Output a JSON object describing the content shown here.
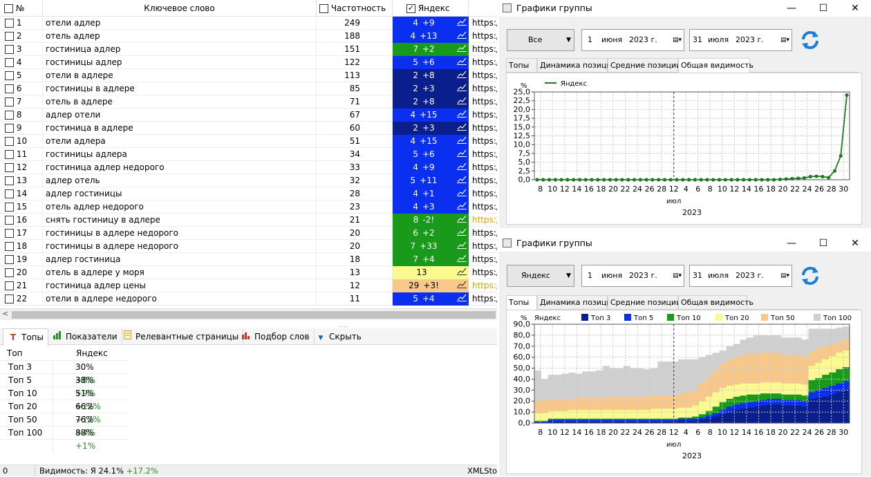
{
  "table": {
    "headers": {
      "num": "№",
      "keyword": "Ключевое слово",
      "freq": "Частотность",
      "yandex": "Яндекс"
    },
    "rows": [
      {
        "n": "1",
        "kw": "отели адлер",
        "f": "249",
        "pos": "4",
        "d": "+9",
        "bg": "#0b2fee",
        "fg": "#ffffff",
        "url": "https:/"
      },
      {
        "n": "2",
        "kw": "отель адлер",
        "f": "188",
        "pos": "4",
        "d": "+13",
        "bg": "#0b2fee",
        "fg": "#ffffff",
        "url": "https:/"
      },
      {
        "n": "3",
        "kw": "гостиница адлер",
        "f": "151",
        "pos": "7",
        "d": "+2",
        "bg": "#1a9a1a",
        "fg": "#ffffff",
        "url": "https:/"
      },
      {
        "n": "4",
        "kw": "гостиницы адлер",
        "f": "122",
        "pos": "5",
        "d": "+6",
        "bg": "#0b2fee",
        "fg": "#ffffff",
        "url": "https:/"
      },
      {
        "n": "5",
        "kw": "отели в адлере",
        "f": "113",
        "pos": "2",
        "d": "+8",
        "bg": "#0a1e8c",
        "fg": "#ffffff",
        "url": "https:/"
      },
      {
        "n": "6",
        "kw": "гостиницы в адлере",
        "f": "85",
        "pos": "2",
        "d": "+3",
        "bg": "#0a1e8c",
        "fg": "#ffffff",
        "url": "https:/"
      },
      {
        "n": "7",
        "kw": "отель в адлере",
        "f": "71",
        "pos": "2",
        "d": "+8",
        "bg": "#0a1e8c",
        "fg": "#ffffff",
        "url": "https:/"
      },
      {
        "n": "8",
        "kw": "адлер отели",
        "f": "67",
        "pos": "4",
        "d": "+15",
        "bg": "#0b2fee",
        "fg": "#ffffff",
        "url": "https:/"
      },
      {
        "n": "9",
        "kw": "гостиница в адлере",
        "f": "60",
        "pos": "2",
        "d": "+3",
        "bg": "#0a1e8c",
        "fg": "#ffffff",
        "url": "https:/"
      },
      {
        "n": "10",
        "kw": "отели адлера",
        "f": "51",
        "pos": "4",
        "d": "+15",
        "bg": "#0b2fee",
        "fg": "#ffffff",
        "url": "https:/"
      },
      {
        "n": "11",
        "kw": "гостиницы адлера",
        "f": "34",
        "pos": "5",
        "d": "+6",
        "bg": "#0b2fee",
        "fg": "#ffffff",
        "url": "https:/"
      },
      {
        "n": "12",
        "kw": "гостиница адлер недорого",
        "f": "33",
        "pos": "4",
        "d": "+9",
        "bg": "#0b2fee",
        "fg": "#ffffff",
        "url": "https:/"
      },
      {
        "n": "13",
        "kw": "адлер отель",
        "f": "32",
        "pos": "5",
        "d": "+11",
        "bg": "#0b2fee",
        "fg": "#ffffff",
        "url": "https:/"
      },
      {
        "n": "14",
        "kw": "адлер гостиницы",
        "f": "28",
        "pos": "4",
        "d": "+1",
        "bg": "#0b2fee",
        "fg": "#ffffff",
        "url": "https:/"
      },
      {
        "n": "15",
        "kw": "отель адлер недорого",
        "f": "23",
        "pos": "4",
        "d": "+3",
        "bg": "#0b2fee",
        "fg": "#ffffff",
        "url": "https:/"
      },
      {
        "n": "16",
        "kw": "снять гостиницу в адлере",
        "f": "21",
        "pos": "8",
        "d": "-2!",
        "bg": "#1a9a1a",
        "fg": "#ffffff",
        "url": "https:/",
        "urlc": "#e0a000"
      },
      {
        "n": "17",
        "kw": "гостиницы в адлере недорого",
        "f": "20",
        "pos": "6",
        "d": "+2",
        "bg": "#1a9a1a",
        "fg": "#ffffff",
        "url": "https:/"
      },
      {
        "n": "18",
        "kw": "гостиницы в адлере недорого",
        "f": "20",
        "pos": "7",
        "d": "+33",
        "bg": "#1a9a1a",
        "fg": "#ffffff",
        "url": "https:/"
      },
      {
        "n": "19",
        "kw": "адлер гостиница",
        "f": "18",
        "pos": "7",
        "d": "+4",
        "bg": "#1a9a1a",
        "fg": "#ffffff",
        "url": "https:/"
      },
      {
        "n": "20",
        "kw": "отель в адлере у моря",
        "f": "13",
        "pos": "13",
        "d": "",
        "bg": "#fafa90",
        "fg": "#000000",
        "url": "https:/"
      },
      {
        "n": "21",
        "kw": "гостиница адлер цены",
        "f": "12",
        "pos": "29",
        "d": "+3!",
        "bg": "#f7c88a",
        "fg": "#000000",
        "url": "https:/",
        "urlc": "#e0a000"
      },
      {
        "n": "22",
        "kw": "отели в адлере недорого",
        "f": "11",
        "pos": "5",
        "d": "+4",
        "bg": "#0b2fee",
        "fg": "#ffffff",
        "url": "https:/"
      }
    ]
  },
  "bottom_tabs": [
    "Топы",
    "Показатели",
    "Релевантные страницы",
    "Подбор слов",
    "Скрыть"
  ],
  "tops": {
    "col1": "Топ",
    "col2": "Яндекс",
    "rows": [
      {
        "name": "Топ 3",
        "pct": "30%",
        "d": "+8%"
      },
      {
        "name": "Топ 5",
        "pct": "38%",
        "d": "+9%"
      },
      {
        "name": "Топ 10",
        "pct": "51%",
        "d": "+12%"
      },
      {
        "name": "Топ 20",
        "pct": "66%",
        "d": "+12%"
      },
      {
        "name": "Топ 50",
        "pct": "76%",
        "d": "+4%"
      },
      {
        "name": "Топ 100",
        "pct": "88%",
        "d": "+1%"
      }
    ]
  },
  "status": {
    "count": "0",
    "vis_label": "Видимость:",
    "vis_engine": "Я",
    "vis_value": "24.1%",
    "vis_delta": "+17.2%",
    "right": "XMLSto"
  },
  "win1": {
    "title": "Графики группы",
    "engine_select": "Все",
    "date_from": {
      "d": "1",
      "m": "июня",
      "y": "2023 г."
    },
    "date_to": {
      "d": "31",
      "m": "июля",
      "y": "2023 г."
    },
    "tabs": [
      "Топы",
      "Динамика позиций",
      "Средние позиции",
      "Общая видимость"
    ],
    "active_tab": 3
  },
  "win2": {
    "title": "Графики группы",
    "engine_select": "Яндекс",
    "date_from": {
      "d": "1",
      "m": "июня",
      "y": "2023 г."
    },
    "date_to": {
      "d": "31",
      "m": "июля",
      "y": "2023 г."
    },
    "tabs": [
      "Топы",
      "Динамика позиций",
      "Средние позиции",
      "Общая видимость"
    ],
    "active_tab": 0
  },
  "colors": {
    "top3": "#0a1e8c",
    "top5": "#0b2fee",
    "top10": "#1a9a1a",
    "top20": "#fafa90",
    "top50": "#f7c88a",
    "top100": "#d0d0d0",
    "line": "#1f7a1f"
  },
  "chart_data": [
    {
      "type": "line",
      "ylabel": "%",
      "legend": [
        "Яндекс"
      ],
      "ylim": [
        0,
        25
      ],
      "yticks": [
        "0,0",
        "2,5",
        "5,0",
        "7,5",
        "10,0",
        "12,5",
        "15,0",
        "17,5",
        "20,0",
        "22,5",
        "25,0"
      ],
      "xticks": [
        "8",
        "10",
        "12",
        "14",
        "16",
        "18",
        "20",
        "22",
        "24",
        "26",
        "28",
        "12",
        "4",
        "6",
        "8",
        "10",
        "12",
        "14",
        "16",
        "18",
        "20",
        "22",
        "24",
        "26",
        "28",
        "30"
      ],
      "xlabel_month": "июл",
      "xlabel_year": "2023",
      "series": [
        {
          "name": "Яндекс",
          "values": [
            0,
            0,
            0,
            0,
            0,
            0,
            0,
            0,
            0,
            0,
            0,
            0,
            0,
            0,
            0,
            0,
            0,
            0,
            0,
            0,
            0,
            0,
            0,
            0,
            0,
            0,
            0,
            0,
            0,
            0,
            0,
            0,
            0,
            0,
            0,
            0,
            0,
            0,
            0,
            0,
            0.1,
            0.2,
            0.3,
            0.4,
            0.5,
            0.9,
            1.0,
            0.9,
            0.6,
            2.5,
            6.8,
            24.1
          ]
        }
      ]
    },
    {
      "type": "area",
      "ylabel": "%",
      "legend": [
        "Яндекс",
        "Топ 3",
        "Топ 5",
        "Топ 10",
        "Топ 20",
        "Топ 50",
        "Топ 100"
      ],
      "ylim": [
        0,
        90
      ],
      "yticks": [
        "0,0",
        "10,0",
        "20,0",
        "30,0",
        "40,0",
        "50,0",
        "60,0",
        "70,0",
        "80,0",
        "90,0"
      ],
      "xticks": [
        "8",
        "10",
        "12",
        "14",
        "16",
        "18",
        "20",
        "22",
        "24",
        "26",
        "28",
        "12",
        "4",
        "6",
        "8",
        "10",
        "12",
        "14",
        "16",
        "18",
        "20",
        "22",
        "24",
        "26",
        "28",
        "30"
      ],
      "xlabel_month": "июл",
      "xlabel_year": "2023",
      "series": [
        {
          "name": "Топ 3",
          "values": [
            0,
            0,
            1,
            1,
            1,
            1,
            1,
            1,
            1,
            1,
            1,
            1,
            1,
            1,
            1,
            1,
            1,
            1,
            1,
            1,
            1,
            2,
            2,
            2,
            3,
            4,
            6,
            8,
            10,
            12,
            13,
            14,
            15,
            16,
            17,
            17,
            16,
            16,
            16,
            15,
            22,
            23,
            24,
            26,
            28,
            30
          ]
        },
        {
          "name": "Топ 5",
          "values": [
            1,
            1,
            3,
            3,
            3,
            3,
            3,
            3,
            3,
            3,
            3,
            3,
            3,
            3,
            3,
            3,
            3,
            3,
            3,
            3,
            3,
            4,
            4,
            4,
            5,
            7,
            9,
            12,
            15,
            17,
            18,
            19,
            20,
            21,
            22,
            22,
            21,
            21,
            21,
            20,
            28,
            30,
            32,
            34,
            36,
            38
          ]
        },
        {
          "name": "Топ 10",
          "values": [
            2,
            2,
            4,
            4,
            4,
            4,
            4,
            4,
            4,
            4,
            4,
            4,
            4,
            4,
            4,
            4,
            4,
            4,
            4,
            4,
            4,
            5,
            5,
            6,
            8,
            11,
            15,
            19,
            22,
            24,
            25,
            26,
            26,
            27,
            27,
            27,
            26,
            26,
            26,
            25,
            39,
            41,
            44,
            46,
            49,
            51
          ]
        },
        {
          "name": "Топ 20",
          "values": [
            9,
            9,
            11,
            11,
            11,
            12,
            12,
            12,
            12,
            12,
            12,
            12,
            12,
            12,
            12,
            12,
            12,
            13,
            13,
            13,
            13,
            14,
            14,
            16,
            20,
            24,
            28,
            32,
            34,
            35,
            36,
            36,
            36,
            37,
            37,
            37,
            36,
            36,
            36,
            35,
            52,
            55,
            58,
            61,
            64,
            66
          ]
        },
        {
          "name": "Топ 50",
          "values": [
            20,
            21,
            22,
            22,
            22,
            22,
            23,
            23,
            23,
            23,
            23,
            24,
            24,
            24,
            24,
            24,
            24,
            25,
            25,
            25,
            25,
            27,
            28,
            30,
            36,
            42,
            48,
            54,
            58,
            60,
            62,
            63,
            63,
            64,
            64,
            64,
            62,
            62,
            62,
            60,
            65,
            68,
            70,
            72,
            74,
            76
          ]
        },
        {
          "name": "Топ 100",
          "values": [
            48,
            40,
            44,
            44,
            45,
            46,
            45,
            47,
            47,
            48,
            52,
            50,
            50,
            52,
            50,
            50,
            49,
            50,
            56,
            56,
            56,
            58,
            58,
            58,
            60,
            62,
            64,
            66,
            70,
            72,
            76,
            78,
            80,
            80,
            80,
            80,
            78,
            78,
            78,
            76,
            86,
            86,
            86,
            86,
            87,
            88
          ]
        }
      ]
    }
  ]
}
